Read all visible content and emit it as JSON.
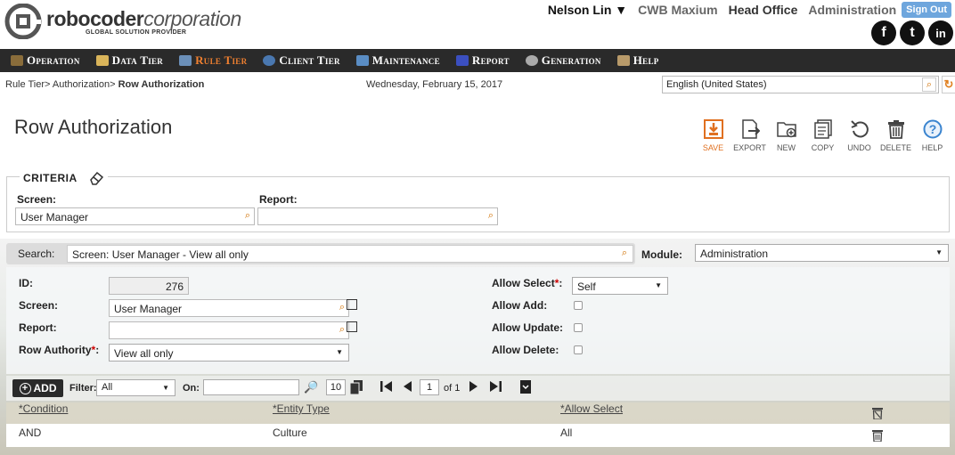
{
  "header": {
    "logo_main": "robocoder",
    "logo_light": "corporation",
    "logo_sub": "GLOBAL SOLUTION PROVIDER",
    "user_name": "Nelson Lin ▼",
    "company": "CWB Maxium",
    "office": "Head Office",
    "admin": "Administration",
    "signout": "Sign Out",
    "social": [
      "f",
      "t",
      "in"
    ]
  },
  "nav": [
    {
      "label": "Operation",
      "icon": "operation-icon",
      "active": false
    },
    {
      "label": "Data Tier",
      "icon": "data-tier-icon",
      "active": false
    },
    {
      "label": "Rule Tier",
      "icon": "rule-tier-icon",
      "active": true
    },
    {
      "label": "Client Tier",
      "icon": "client-tier-icon",
      "active": false
    },
    {
      "label": "Maintenance",
      "icon": "maintenance-icon",
      "active": false
    },
    {
      "label": "Report",
      "icon": "report-icon",
      "active": false
    },
    {
      "label": "Generation",
      "icon": "generation-icon",
      "active": false
    },
    {
      "label": "Help",
      "icon": "help-icon",
      "active": false
    }
  ],
  "breadcrumb": {
    "path": "Rule Tier> Authorization> ",
    "current": "Row Authorization"
  },
  "date": "Wednesday, February 15, 2017",
  "language": "English (United States)",
  "page_title": "Row Authorization",
  "toolbar": {
    "save": "SAVE",
    "export": "EXPORT",
    "new": "NEW",
    "copy": "COPY",
    "undo": "UNDO",
    "delete": "DELETE",
    "help": "HELP"
  },
  "criteria": {
    "title": "CRITERIA",
    "screen_label": "Screen:",
    "screen_value": "User Manager",
    "report_label": "Report:",
    "report_value": ""
  },
  "search": {
    "label": "Search:",
    "value": "Screen: User Manager - View all only"
  },
  "module": {
    "label": "Module:",
    "value": "Administration"
  },
  "form": {
    "id_label": "ID:",
    "id_value": "276",
    "screen_label": "Screen:",
    "screen_value": "User Manager",
    "report_label": "Report:",
    "report_value": "",
    "row_authority_label": "Row Authority",
    "row_authority_value": "View all only",
    "allow_select_label": "Allow Select",
    "allow_select_value": "Self",
    "allow_add_label": "Allow Add:",
    "allow_update_label": "Allow Update:",
    "allow_delete_label": "Allow Delete:",
    "required_mark": "*",
    "colon": ":"
  },
  "grid": {
    "add_label": "ADD",
    "filter_label": "Filter:",
    "filter_value": "All",
    "on_label": "On:",
    "on_value": "",
    "page_size": "10",
    "page": "1",
    "of_label": "of 1",
    "columns": [
      "*Condition",
      "*Entity Type",
      "*Allow Select"
    ],
    "rows": [
      {
        "condition": "AND",
        "entity_type": "Culture",
        "allow_select": "All"
      }
    ]
  }
}
